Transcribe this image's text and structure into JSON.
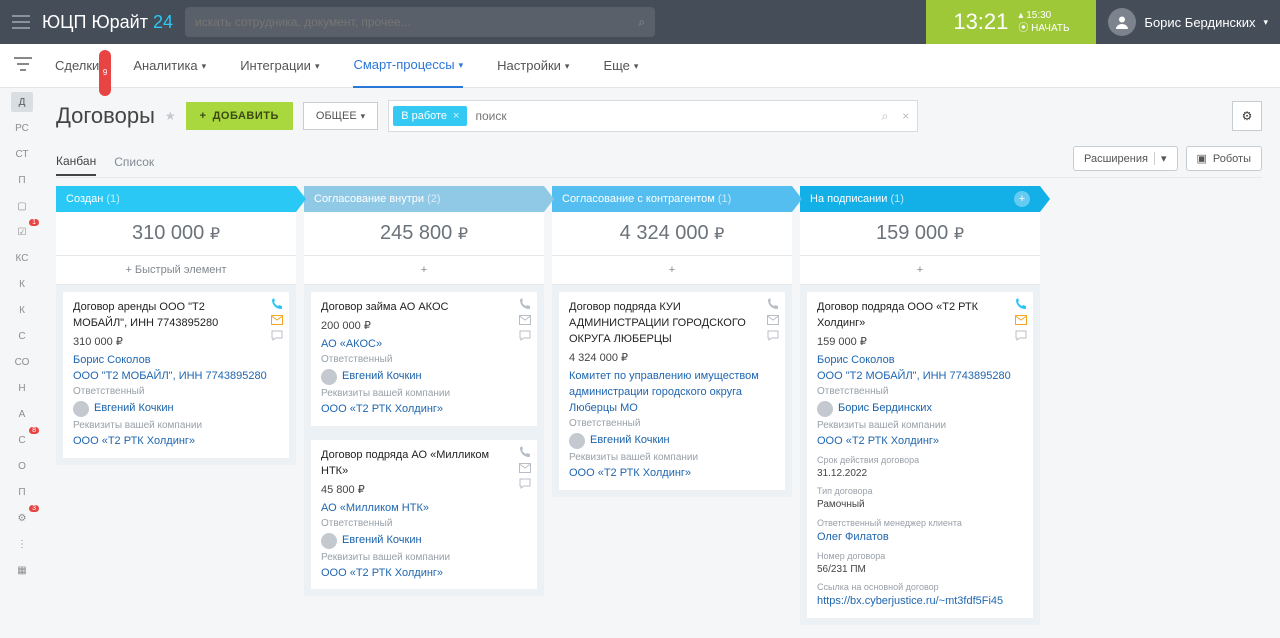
{
  "header": {
    "logo_main": "ЮЦП Юрайт",
    "logo_accent": "24",
    "search_placeholder": "искать сотрудника, документ, прочее...",
    "clock_time": "13:21",
    "clock_end": "15:30",
    "clock_action": "НАЧАТЬ",
    "user_name": "Борис Бердинских"
  },
  "nav": {
    "items": [
      {
        "label": "Сделки",
        "badge": "9"
      },
      {
        "label": "Аналитика"
      },
      {
        "label": "Интеграции"
      },
      {
        "label": "Смарт-процессы",
        "active": true
      },
      {
        "label": "Настройки"
      },
      {
        "label": "Еще"
      }
    ]
  },
  "leftbar": [
    "Д",
    "РС",
    "СТ",
    "П",
    "▢",
    "☑",
    "КС",
    "К",
    "К",
    "С",
    "СО",
    "Н",
    "А",
    "С",
    "О",
    "П",
    "⚙",
    "⋮",
    "▦"
  ],
  "leftbar_badges": {
    "5": "1",
    "13": "8",
    "16": "3"
  },
  "page": {
    "title": "Договоры",
    "add_btn": "ДОБАВИТЬ",
    "common_btn": "ОБЩЕЕ",
    "filter_chip": "В работе",
    "filter_placeholder": "поиск",
    "tabs": [
      "Канбан",
      "Список"
    ],
    "ext_btn": "Расширения",
    "robots_btn": "Роботы"
  },
  "columns": [
    {
      "title": "Создан",
      "count": "(1)",
      "sum": "310 000",
      "hclass": "blue1",
      "quick": "+  Быстрый элемент",
      "cards": [
        {
          "title": "Договор аренды ООО \"Т2 МОБАЙЛ\", ИНН 7743895280",
          "price": "310 000 ₽",
          "contact": "Борис Соколов",
          "company": "ООО \"Т2 МОБАЙЛ\", ИНН 7743895280",
          "resp_lbl": "Ответственный",
          "resp": "Евгений Кочкин",
          "req_lbl": "Реквизиты вашей компании",
          "req": "ООО «Т2 РТК Холдинг»",
          "phone": true,
          "mail": "a"
        }
      ]
    },
    {
      "title": "Согласование внутри",
      "count": "(2)",
      "sum": "245 800",
      "hclass": "blue2",
      "quick": "+",
      "cards": [
        {
          "title": "Договор займа АО АКОС",
          "price": "200 000 ₽",
          "company": "АО «АКОС»",
          "resp_lbl": "Ответственный",
          "resp": "Евгений Кочкин",
          "req_lbl": "Реквизиты вашей компании",
          "req": "ООО «Т2 РТК Холдинг»"
        },
        {
          "title": "Договор подряда АО «Милликом НТК»",
          "price": "45 800 ₽",
          "company": "АО «Милликом НТК»",
          "resp_lbl": "Ответственный",
          "resp": "Евгений Кочкин",
          "req_lbl": "Реквизиты вашей компании",
          "req": "ООО «Т2 РТК Холдинг»"
        }
      ]
    },
    {
      "title": "Согласование с контрагентом",
      "count": "(1)",
      "sum": "4 324 000",
      "hclass": "blue3",
      "quick": "+",
      "cards": [
        {
          "title": "Договор подряда КУИ АДМИНИСТРАЦИИ ГОРОДСКОГО ОКРУГА ЛЮБЕРЦЫ",
          "price": "4 324 000 ₽",
          "company": "Комитет по управлению имуществом администрации городского округа Люберцы МО",
          "resp_lbl": "Ответственный",
          "resp": "Евгений Кочкин",
          "req_lbl": "Реквизиты вашей компании",
          "req": "ООО «Т2 РТК Холдинг»"
        }
      ]
    },
    {
      "title": "На подписании",
      "count": "(1)",
      "sum": "159 000",
      "hclass": "blue4",
      "quick": "+",
      "plusbtn": true,
      "cards": [
        {
          "title": "Договор подряда ООО «Т2 РТК Холдинг»",
          "price": "159 000 ₽",
          "contact": "Борис Соколов",
          "company": "ООО \"Т2 МОБАЙЛ\", ИНН 7743895280",
          "resp_lbl": "Ответственный",
          "resp": "Борис Бердинских",
          "req_lbl": "Реквизиты вашей компании",
          "req": "ООО «Т2 РТК Холдинг»",
          "phone": true,
          "mail": "a",
          "extra": [
            {
              "lbl": "Срок действия договора",
              "val": "31.12.2022"
            },
            {
              "lbl": "Тип договора",
              "val": "Рамочный"
            },
            {
              "lbl": "Ответственный менеджер клиента",
              "val": "Олег Филатов",
              "link": true
            },
            {
              "lbl": "Номер договора",
              "val": "56/231 ПМ"
            },
            {
              "lbl": "Ссылка на основной договор",
              "val": "https://bx.cyberjustice.ru/~mt3fdf5Fi45",
              "link": true
            }
          ]
        }
      ]
    }
  ]
}
